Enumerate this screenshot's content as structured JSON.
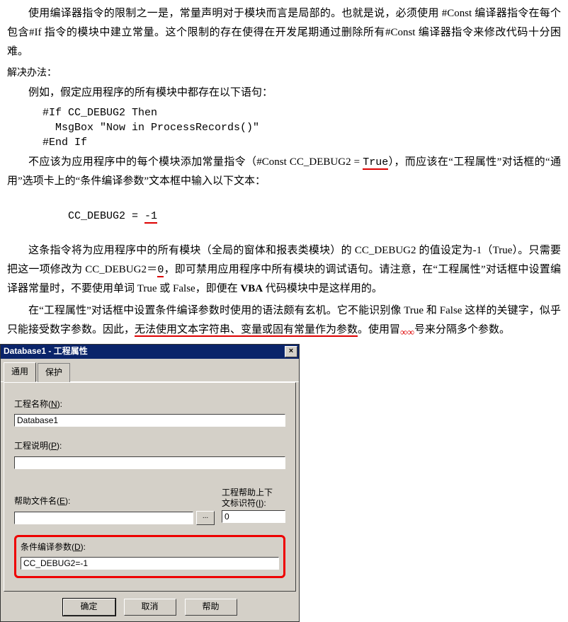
{
  "doc": {
    "p1": "使用编译器指令的限制之一是，常量声明对于模块而言是局部的。也就是说，必须使用 #Const 编译器指令在每个包含#If 指令的模块中建立常量。这个限制的存在使得在开发尾期通过删除所有#Const 编译器指令来修改代码十分困难。",
    "solve": "解决办法：",
    "p2": "例如，假定应用程序的所有模块中都存在以下语句：",
    "code1": "#If CC_DEBUG2 Then\n  MsgBox \"Now in ProcessRecords()\"\n#End If",
    "p3a": "不应该为应用程序中的每个模块添加常量指令（#Const CC_DEBUG2 = ",
    "p3_true": "True",
    "p3b": "），而应该在“工程属性”对话框的“通用”选项卡上的“条件编译参数”文本框中输入以下文本：",
    "code2a": "CC_DEBUG2 = ",
    "code2b": "-1",
    "p4a": "这条指令将为应用程序中的所有模块（全局的窗体和报表类模块）的 CC_DEBUG2 的值设定为-1（True）。只需要把这一项修改为 CC_DEBUG2＝",
    "p4_zero": "0",
    "p4b": "，即可禁用应用程序中所有模块的调试语句。请注意，在“工程属性”对话框中设置编译器常量时，不要使用单词 True 或 False，即便在 ",
    "p4_vba": "VBA",
    "p4c": " 代码模块中是这样用的。",
    "p5a": "在“工程属性”对话框中设置条件编译参数时使用的语法颇有玄机。它不能识别像 True 和 False 这样的关键字，似乎只能接受数字参数。因此，",
    "p5_ul": "无法使用文本字符串、变量或固有常量作为参数",
    "p5b": "。使用",
    "p5_colon": "冒",
    "p5c": "号来分隔多个参数。"
  },
  "dlg": {
    "title": "Database1 - 工程属性",
    "close": "×",
    "tab_general": "通用",
    "tab_protect": "保护",
    "lbl_name_a": "工程名称(",
    "lbl_name_u": "N",
    "lbl_name_b": "):",
    "val_name": "Database1",
    "lbl_desc_a": "工程说明(",
    "lbl_desc_u": "P",
    "lbl_desc_b": "):",
    "val_desc": "",
    "lbl_help_a": "帮助文件名(",
    "lbl_help_u": "E",
    "lbl_help_b": "):",
    "val_help": "",
    "lbl_ctx_a": "工程帮助上下",
    "lbl_ctx_b": "文标识符(",
    "lbl_ctx_u": "I",
    "lbl_ctx_c": "):",
    "val_ctx": "0",
    "browse": "...",
    "lbl_cc_a": "条件编译参数(",
    "lbl_cc_u": "D",
    "lbl_cc_b": "):",
    "val_cc": "CC_DEBUG2=-1",
    "btn_ok": "确定",
    "btn_cancel": "取消",
    "btn_help": "帮助"
  }
}
